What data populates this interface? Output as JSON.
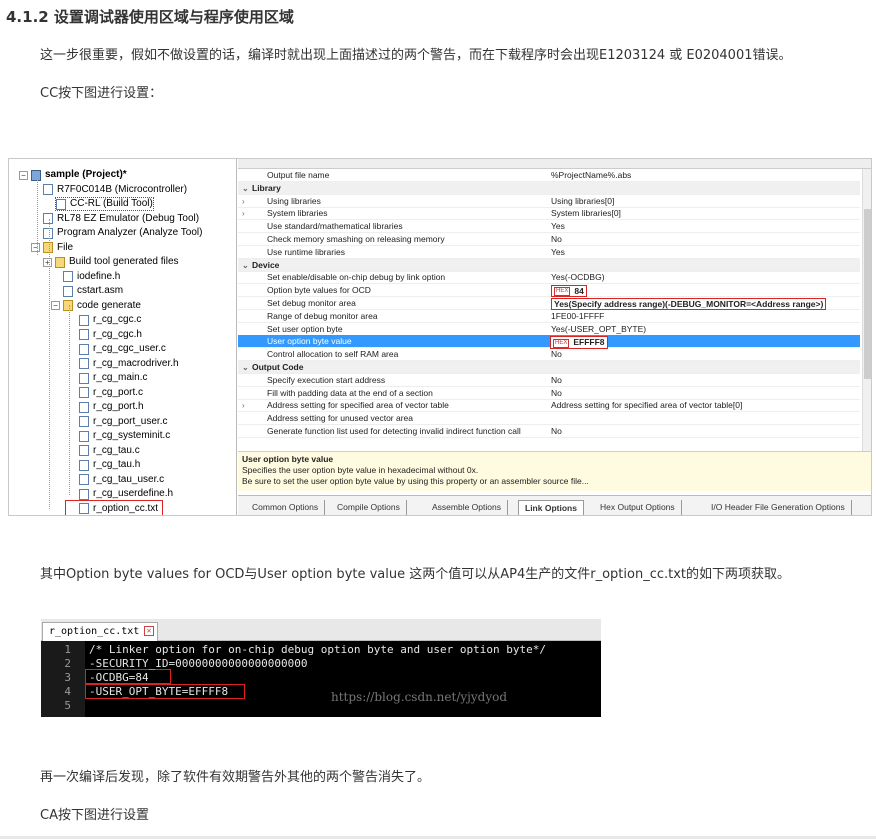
{
  "heading": "4.1.2 设置调试器使用区域与程序使用区域",
  "para1": "这一步很重要，假如不做设置的话，编译时就出现上面描述过的两个警告，而在下载程序时会出现E1203124 或 E0204001错误。",
  "para2": "CC按下图进行设置：",
  "para3": "其中Option byte values for OCD与User option byte value 这两个值可以从AP4生产的文件r_option_cc.txt的如下两项获取。",
  "para4": "再一次编译后发现，除了软件有效期警告外其他的两个警告消失了。",
  "para5": "CA按下图进行设置",
  "shot1": {
    "tree": [
      {
        "label": "sample (Project)*",
        "bold": true
      },
      {
        "label": "R7F0C014B (Microcontroller)"
      },
      {
        "label": "CC-RL (Build Tool)"
      },
      {
        "label": "RL78 EZ Emulator (Debug Tool)"
      },
      {
        "label": "Program Analyzer (Analyze Tool)"
      },
      {
        "label": "File"
      },
      {
        "label": "Build tool generated files"
      },
      {
        "label": "iodefine.h"
      },
      {
        "label": "cstart.asm"
      },
      {
        "label": "code generate"
      },
      {
        "label": "r_cg_cgc.c"
      },
      {
        "label": "r_cg_cgc.h"
      },
      {
        "label": "r_cg_cgc_user.c"
      },
      {
        "label": "r_cg_macrodriver.h"
      },
      {
        "label": "r_cg_main.c"
      },
      {
        "label": "r_cg_port.c"
      },
      {
        "label": "r_cg_port.h"
      },
      {
        "label": "r_cg_port_user.c"
      },
      {
        "label": "r_cg_systeminit.c"
      },
      {
        "label": "r_cg_tau.c"
      },
      {
        "label": "r_cg_tau.h"
      },
      {
        "label": "r_cg_tau_user.c"
      },
      {
        "label": "r_cg_userdefine.h"
      },
      {
        "label": "r_option_cc.txt"
      }
    ],
    "props": [
      {
        "name": "Output file name",
        "value": "%ProjectName%.abs"
      },
      {
        "name": "Library",
        "value": "",
        "category": true
      },
      {
        "name": "Using libraries",
        "value": "Using libraries[0]",
        "chev": true
      },
      {
        "name": "System libraries",
        "value": "System libraries[0]",
        "chev": true
      },
      {
        "name": "Use standard/mathematical libraries",
        "value": "Yes"
      },
      {
        "name": "Check memory smashing on releasing memory",
        "value": "No"
      },
      {
        "name": "Use runtime libraries",
        "value": "Yes"
      },
      {
        "name": "Device",
        "value": "",
        "category": true
      },
      {
        "name": "Set enable/disable on-chip debug by link option",
        "value": "Yes(-OCDBG)"
      },
      {
        "name": "Option byte values for OCD",
        "value": "84",
        "hex": true
      },
      {
        "name": "Set debug monitor area",
        "value": "Yes(Specify address range)(-DEBUG_MONITOR=<Address range>)",
        "bold": true
      },
      {
        "name": "Range of debug monitor area",
        "value": "1FE00-1FFFF"
      },
      {
        "name": "Set user option byte",
        "value": "Yes(-USER_OPT_BYTE)"
      },
      {
        "name": "User option byte value",
        "value": "EFFFF8",
        "hex": true,
        "selected": true
      },
      {
        "name": "Control allocation to self RAM area",
        "value": "No"
      },
      {
        "name": "Output Code",
        "value": "",
        "category": true
      },
      {
        "name": "Specify execution start address",
        "value": "No"
      },
      {
        "name": "Fill with padding data at the end of a section",
        "value": "No"
      },
      {
        "name": "Address setting for specified area of vector table",
        "value": "Address setting for specified area of vector table[0]",
        "chev": true
      },
      {
        "name": "Address setting for unused vector area",
        "value": ""
      },
      {
        "name": "Generate function list used for detecting invalid indirect function call",
        "value": "No"
      }
    ],
    "desc_title": "User option byte value",
    "desc_line1": "Specifies the user option byte value in hexadecimal without 0x.",
    "desc_line2": "Be sure to set the user option byte value by using this property or an assembler source file...",
    "hex_tag": "HEX",
    "tabs": [
      "Common Options",
      "Compile Options",
      "Assemble Options",
      "Link Options",
      "Hex Output Options",
      "I/O Header File Generation Options"
    ],
    "active_tab": "Link Options"
  },
  "shot2": {
    "file_tab": "r_option_cc.txt",
    "lines": [
      {
        "n": "1",
        "text": "/* Linker option for on-chip debug option byte and user option byte*/"
      },
      {
        "n": "2",
        "text": "-SECURITY_ID=00000000000000000000"
      },
      {
        "n": "3",
        "text": "-OCDBG=84"
      },
      {
        "n": "4",
        "text": "-USER_OPT_BYTE=EFFFF8"
      },
      {
        "n": "5",
        "text": ""
      }
    ],
    "watermark": "https://blog.csdn.net/yjydyod"
  },
  "colors": {
    "highlight_box": "#dd2222",
    "selected_row": "#3399ff",
    "desc_bg": "#fffbe0"
  }
}
